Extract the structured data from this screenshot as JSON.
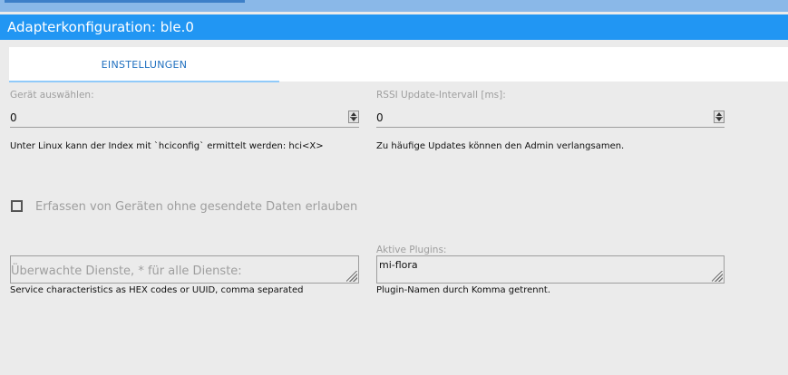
{
  "window": {
    "title": "Adapterkonfiguration: ble.0"
  },
  "tabs": [
    {
      "label": "EINSTELLUNGEN",
      "active": true
    }
  ],
  "device": {
    "label": "Gerät auswählen:",
    "value": "0",
    "help": "Unter Linux kann der Index mit `hciconfig` ermittelt werden: hci<X>"
  },
  "rssi": {
    "label": "RSSI Update-Intervall [ms]:",
    "value": "0",
    "help": "Zu häufige Updates können den Admin verlangsamen."
  },
  "checkbox": {
    "label": "Erfassen von Geräten ohne gesendete Daten erlauben",
    "checked": false
  },
  "services": {
    "placeholder": "Überwachte Dienste, * für alle Dienste:",
    "value": "",
    "help": "Service characteristics as HEX codes or UUID, comma separated"
  },
  "plugins": {
    "label": "Aktive Plugins:",
    "value": "mi-flora",
    "help": "Plugin-Namen durch Komma getrennt."
  },
  "colors": {
    "titlebar": "#2196f3",
    "tab_text": "#1e6fbf",
    "tab_indicator": "#90caf9"
  }
}
